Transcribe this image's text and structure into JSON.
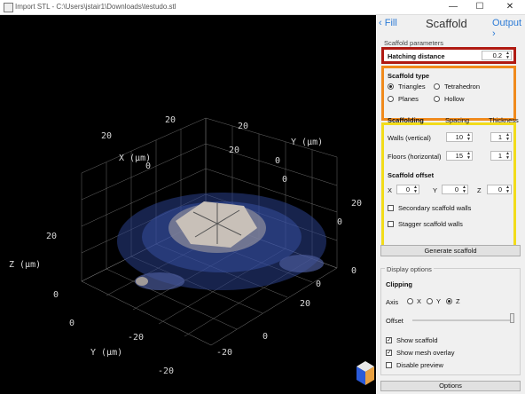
{
  "window": {
    "title": "Import STL - C:\\Users\\jstair1\\Downloads\\testudo.stl",
    "minimize": "—",
    "maximize": "☐",
    "close": "✕"
  },
  "viewport": {
    "x_axis_label": "X (μm)",
    "y_axis_label": "Y (μm)",
    "z_axis_label": "Z (μm)",
    "ticks": {
      "x_top": [
        "20",
        "0"
      ],
      "y_top": [
        "20",
        "0"
      ],
      "z_left": [
        "20",
        "0"
      ],
      "z_right": [
        "20",
        "0"
      ],
      "x_bottom": [
        "-20",
        "-20",
        "0"
      ],
      "y_bottom": [
        "0",
        "-20"
      ],
      "misc": [
        "20",
        "0",
        "0",
        "20",
        "20",
        "0"
      ]
    }
  },
  "panel": {
    "nav": {
      "prev": "Fill",
      "title": "Scaffold",
      "next": "Output"
    },
    "scaffold_parameters_label": "Scaffold parameters",
    "hatching_distance": {
      "label": "Hatching distance",
      "value": "0.2"
    },
    "scaffold_type": {
      "label": "Scaffold type",
      "options": [
        "Triangles",
        "Tetrahedron",
        "Planes",
        "Hollow"
      ],
      "selected": "Triangles"
    },
    "scaffolding": {
      "label": "Scaffolding",
      "col_spacing": "Spacing",
      "col_thickness": "Thickness",
      "walls_label": "Walls (vertical)",
      "walls_spacing": "10",
      "walls_thickness": "1",
      "floors_label": "Floors (horizontal)",
      "floors_spacing": "15",
      "floors_thickness": "1"
    },
    "scaffold_offset": {
      "label": "Scaffold offset",
      "x_label": "X",
      "x_value": "0",
      "y_label": "Y",
      "y_value": "0",
      "z_label": "Z",
      "z_value": "0"
    },
    "secondary_walls": "Secondary scaffold walls",
    "stagger_walls": "Stagger scaffold walls",
    "generate_button": "Generate scaffold",
    "display_options": {
      "label": "Display options",
      "clipping": "Clipping",
      "axis_label": "Axis",
      "axis_x": "X",
      "axis_y": "Y",
      "axis_z": "Z",
      "axis_selected": "Z",
      "offset_label": "Offset",
      "show_scaffold": "Show scaffold",
      "show_mesh_overlay": "Show mesh overlay",
      "disable_preview": "Disable preview"
    },
    "options_button": "Options"
  },
  "colors": {
    "highlight_red": "#b01a12",
    "highlight_orange": "#f08a1c",
    "highlight_yellow": "#f2dc1a",
    "link_blue": "#2c7bd6"
  }
}
